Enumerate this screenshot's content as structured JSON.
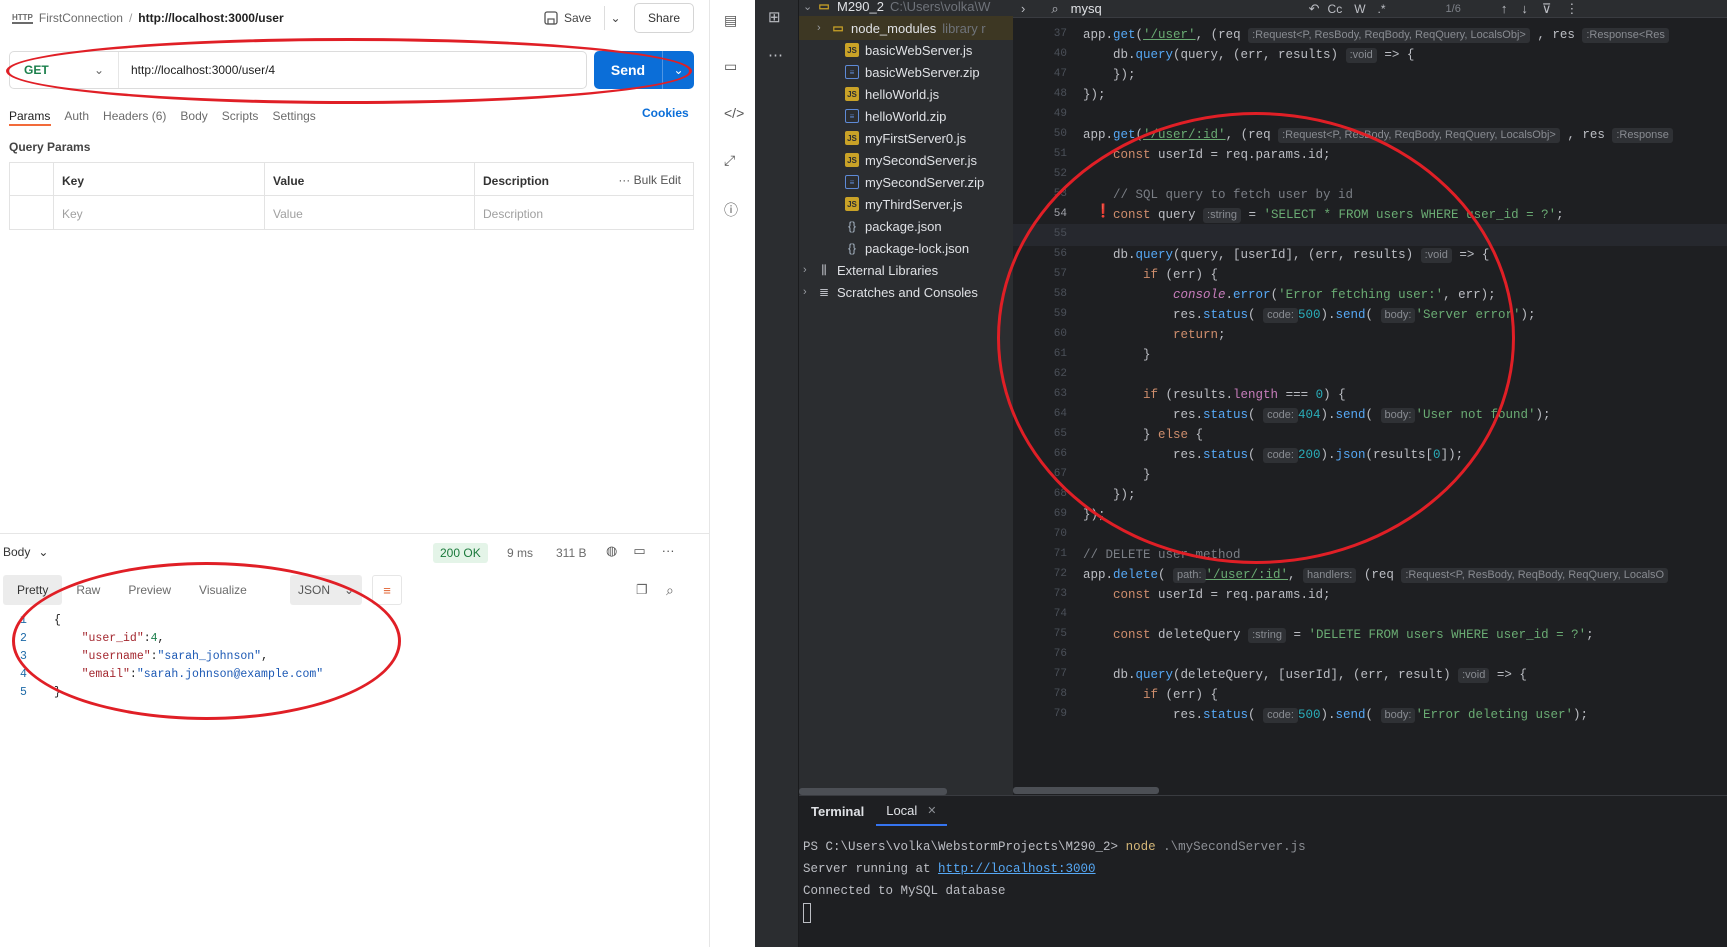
{
  "postman": {
    "breadcrumb": {
      "collection": "FirstConnection",
      "separator": "/",
      "request": "http://localhost:3000/user"
    },
    "save_label": "Save",
    "share_label": "Share",
    "method": "GET",
    "url": "http://localhost:3000/user/4",
    "send_label": "Send",
    "tabs": [
      {
        "label": "Params"
      },
      {
        "label": "Auth"
      },
      {
        "label": "Headers (6)"
      },
      {
        "label": "Body"
      },
      {
        "label": "Scripts"
      },
      {
        "label": "Settings"
      }
    ],
    "cookies_label": "Cookies",
    "query_params": {
      "title": "Query Params",
      "headers": [
        "Key",
        "Value",
        "Description"
      ],
      "bulk_edit": "Bulk Edit",
      "placeholders": [
        "Key",
        "Value",
        "Description"
      ]
    },
    "response": {
      "label": "Body",
      "status": "200 OK",
      "time": "9 ms",
      "size": "311 B",
      "format_tabs": [
        "Pretty",
        "Raw",
        "Preview",
        "Visualize"
      ],
      "format": "JSON",
      "lines": [
        {
          "n": "1",
          "text": "{"
        },
        {
          "n": "2",
          "key": "\"user_id\"",
          "val": "4",
          "type": "num",
          "trail": ","
        },
        {
          "n": "3",
          "key": "\"username\"",
          "val": "\"sarah_johnson\"",
          "type": "str",
          "trail": ","
        },
        {
          "n": "4",
          "key": "\"email\"",
          "val": "\"sarah.johnson@example.com\"",
          "type": "str",
          "trail": ""
        },
        {
          "n": "5",
          "text": "}"
        }
      ]
    }
  },
  "ide": {
    "project": {
      "root": {
        "name": "M290_2",
        "path": "C:\\Users\\volka\\W"
      },
      "items": [
        {
          "name": "node_modules",
          "type": "dir",
          "note": "library r"
        },
        {
          "name": "basicWebServer.js",
          "type": "js"
        },
        {
          "name": "basicWebServer.zip",
          "type": "zip"
        },
        {
          "name": "helloWorld.js",
          "type": "js"
        },
        {
          "name": "helloWorld.zip",
          "type": "zip"
        },
        {
          "name": "myFirstServer0.js",
          "type": "js"
        },
        {
          "name": "mySecondServer.js",
          "type": "js"
        },
        {
          "name": "mySecondServer.zip",
          "type": "zip"
        },
        {
          "name": "myThirdServer.js",
          "type": "js"
        },
        {
          "name": "package.json",
          "type": "json"
        },
        {
          "name": "package-lock.json",
          "type": "json"
        }
      ],
      "extra": [
        {
          "name": "External Libraries"
        },
        {
          "name": "Scratches and Consoles"
        }
      ]
    },
    "find": {
      "query": "mysq",
      "options": [
        "Cc",
        "W",
        ".*"
      ],
      "count": "1/6"
    },
    "gutter": [
      "37",
      "40",
      "47",
      "48",
      "49",
      "50",
      "51",
      "52",
      "53",
      "54",
      "55",
      "56",
      "57",
      "58",
      "59",
      "60",
      "61",
      "62",
      "63",
      "64",
      "65",
      "66",
      "67",
      "68",
      "69",
      "70",
      "71",
      "72",
      "73",
      "74",
      "75",
      "76",
      "77",
      "78",
      "79"
    ],
    "current_line": "54",
    "code": {
      "l37": {
        "pre": "app.",
        "fn": "get",
        "open": "(",
        "path": "'/user'",
        "mid": ", (req ",
        "hint": ":Request<P, ResBody, ReqBody, ReqQuery, LocalsObj>",
        "post": " , res ",
        "hint2": ":Response<Res"
      },
      "l40": {
        "pre": "    db.",
        "fn": "query",
        "args": "(query, (err, results) ",
        "hint": ":void",
        "post": " => {"
      },
      "l47": "    });",
      "l48": "});",
      "l50": {
        "pre": "app.",
        "fn": "get",
        "open": "(",
        "path": "'/user/:id'",
        "mid": ", (req ",
        "hint": ":Request<P, ResBody, ReqBody, ReqQuery, LocalsObj>",
        "post": " , res ",
        "hint2": ":Response"
      },
      "l51": {
        "kw": "const",
        "rest": " userId = req.params.id;"
      },
      "l53": "// SQL query to fetch user by id",
      "l54": {
        "kw": "const",
        "name": " query ",
        "hint": ":string",
        "eq": " = ",
        "str": "'SELECT * FROM users WHERE user_id = ?'",
        "end": ";"
      },
      "l56": {
        "pre": "db.",
        "fn": "query",
        "args": "(query, [userId], (err, results) ",
        "hint": ":void",
        "post": " => {"
      },
      "l57": {
        "kw": "if",
        "rest": " (err) {"
      },
      "l58": {
        "obj": "console",
        "dot": ".",
        "fn": "error",
        "open": "(",
        "str": "'Error fetching user:'",
        "rest": ", err);"
      },
      "l59": {
        "pre": "res.",
        "fn": "status",
        "open": "( ",
        "hint": "code:",
        "num": "500",
        "mid": ").",
        "fn2": "send",
        "open2": "( ",
        "hint2": "body:",
        "str": "'Server error'",
        "end": ");"
      },
      "l60": {
        "kw": "return",
        "rest": ";"
      },
      "l61": "}",
      "l63": {
        "kw": "if",
        "a": " (results.",
        "prop": "length",
        "b": " === ",
        "num": "0",
        "c": ") {"
      },
      "l64": {
        "pre": "res.",
        "fn": "status",
        "open": "( ",
        "hint": "code:",
        "num": "404",
        "mid": ").",
        "fn2": "send",
        "open2": "( ",
        "hint2": "body:",
        "str": "'User not found'",
        "end": ");"
      },
      "l65": {
        "a": "} ",
        "kw": "else",
        "b": " {"
      },
      "l66": {
        "pre": "res.",
        "fn": "status",
        "open": "( ",
        "hint": "code:",
        "num": "200",
        "mid": ").",
        "fn2": "json",
        "rest": "(results[",
        "num2": "0",
        "end": "]);"
      },
      "l67": "}",
      "l68": "});",
      "l69": "});",
      "l71": "// DELETE user method",
      "l72": {
        "pre": "app.",
        "fn": "delete",
        "open": "( ",
        "hint": "path:",
        "path": "'/user/:id'",
        "mid": ", ",
        "hint2": "handlers:",
        "post": " (req ",
        "hint3": ":Request<P, ResBody, ReqBody, ReqQuery, LocalsO"
      },
      "l73": {
        "kw": "const",
        "rest": " userId = req.params.id;"
      },
      "l75": {
        "kw": "const",
        "name": " deleteQuery ",
        "hint": ":string",
        "eq": " = ",
        "str": "'DELETE FROM users WHERE user_id = ?'",
        "end": ";"
      },
      "l77": {
        "pre": "db.",
        "fn": "query",
        "args": "(deleteQuery, [userId], (err, result) ",
        "hint": ":void",
        "post": " => {"
      },
      "l78": {
        "kw": "if",
        "rest": " (err) {"
      },
      "l79": {
        "pre": "res.",
        "fn": "status",
        "open": "( ",
        "hint": "code:",
        "num": "500",
        "mid": ").",
        "fn2": "send",
        "open2": "( ",
        "hint2": "body:",
        "str": "'Error deleting user'",
        "end": ");"
      }
    },
    "terminal": {
      "title": "Terminal",
      "tab": "Local",
      "prompt": "PS C:\\Users\\volka\\WebstormProjects\\M290_2> ",
      "cmd": "node",
      "arg": " .\\mySecondServer.js",
      "line2_pre": "Server running at ",
      "line2_link": "http://localhost:3000",
      "line3": "Connected to MySQL database"
    }
  },
  "colors": {
    "annotation": "#e01f26",
    "send": "#0b6ed8",
    "ide_bg": "#1e1f22"
  }
}
